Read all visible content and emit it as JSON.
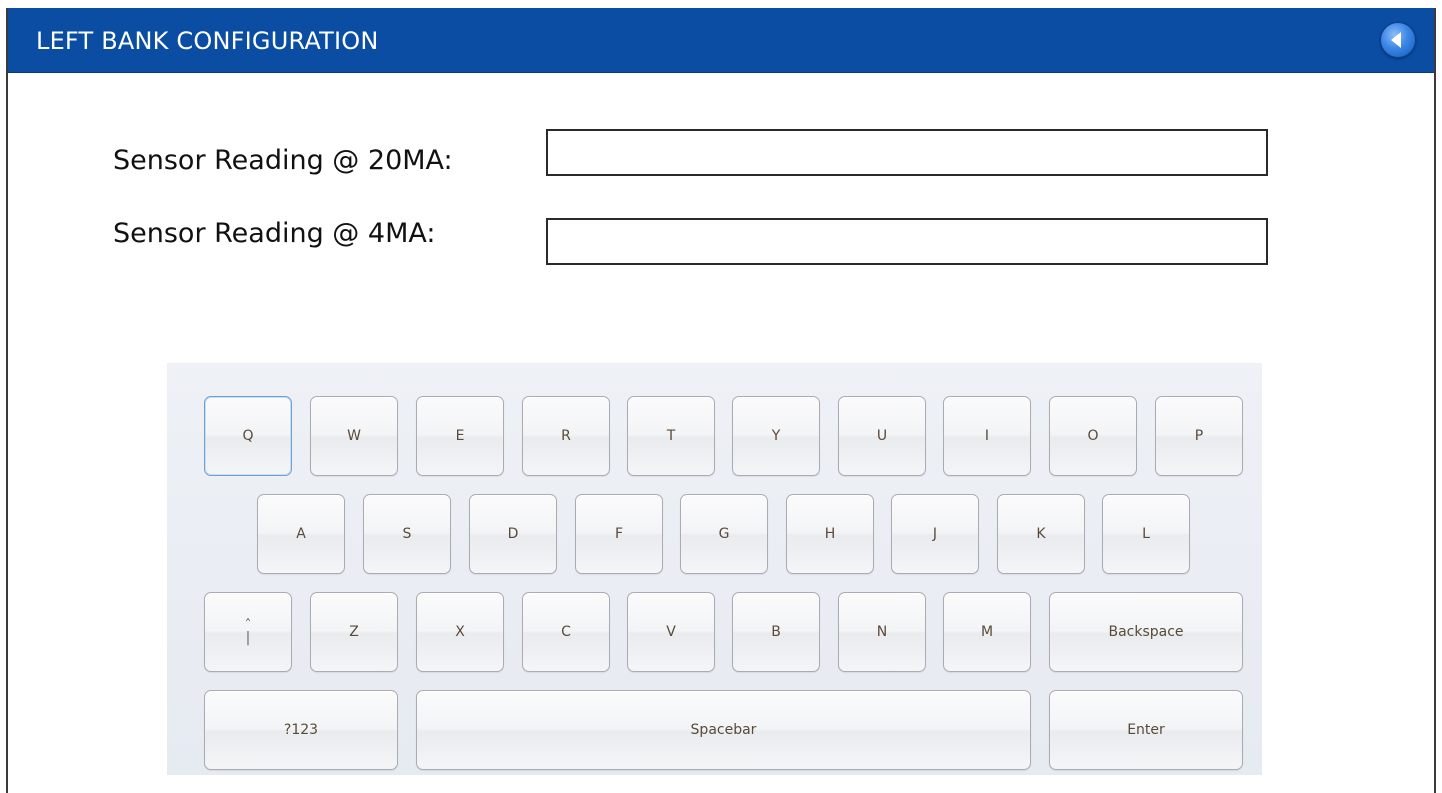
{
  "header": {
    "title": "LEFT BANK CONFIGURATION",
    "back_icon": "back-arrow-icon",
    "accent_color": "#0a4da2"
  },
  "form": {
    "field_20ma": {
      "label": "Sensor Reading @ 20MA:",
      "value": ""
    },
    "field_4ma": {
      "label": "Sensor Reading @ 4MA:",
      "value": ""
    }
  },
  "keyboard": {
    "row1": [
      "Q",
      "W",
      "E",
      "R",
      "T",
      "Y",
      "U",
      "I",
      "O",
      "P"
    ],
    "row2": [
      "A",
      "S",
      "D",
      "F",
      "G",
      "H",
      "J",
      "K",
      "L"
    ],
    "row3": [
      "Z",
      "X",
      "C",
      "V",
      "B",
      "N",
      "M"
    ],
    "shift_icon": "shift-caret-icon",
    "backspace": "Backspace",
    "numbers": "?123",
    "spacebar": "Spacebar",
    "enter": "Enter"
  }
}
